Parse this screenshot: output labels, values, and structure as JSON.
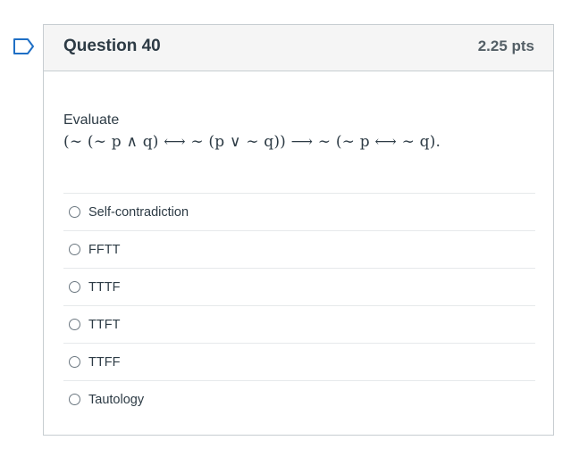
{
  "question": {
    "title": "Question 40",
    "points": "2.25 pts",
    "prompt": "Evaluate",
    "formula": "(∼ (∼ p ∧ q) ⟷ ∼ (p ∨ ∼ q)) ⟶ ∼ (∼ p ⟷ ∼ q)."
  },
  "answers": [
    {
      "label": "Self-contradiction"
    },
    {
      "label": "FFTT"
    },
    {
      "label": "TTTF"
    },
    {
      "label": "TTFT"
    },
    {
      "label": "TTFF"
    },
    {
      "label": "Tautology"
    }
  ],
  "colors": {
    "flag": "#1f6fc5",
    "header_bg": "#f5f5f5",
    "border": "#c7cdd1",
    "text": "#2d3b45"
  }
}
